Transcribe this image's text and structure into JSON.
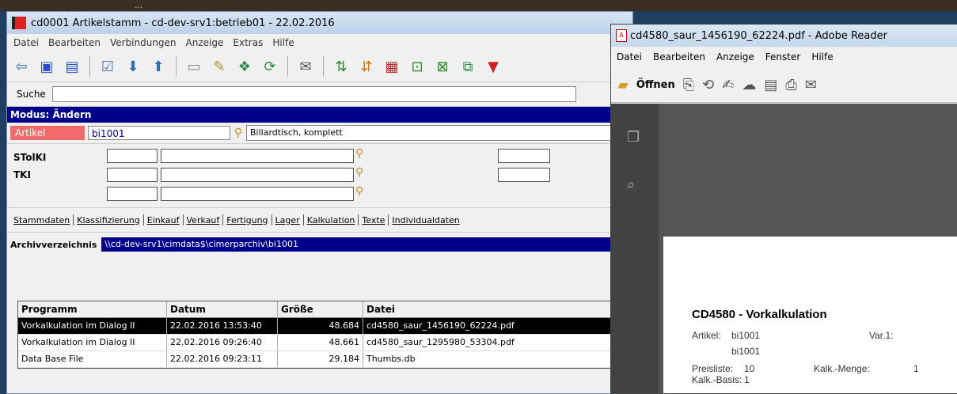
{
  "background": {
    "text": "..."
  },
  "main_window": {
    "title": "cd0001 Artikelstamm - cd-dev-srv1:betrieb01 - 22.02.2016",
    "menu": [
      "Datei",
      "Bearbeiten",
      "Verbindungen",
      "Anzeige",
      "Extras",
      "Hilfe"
    ],
    "search_label": "Suche",
    "mode": "Modus: Ändern",
    "artikel_label": "Artikel",
    "artikel_value": "bi1001",
    "artikel_desc": "Billardtisch, komplett",
    "stk_label": "STolKI",
    "tki_label": "TKI",
    "tabs": [
      "Stammdaten",
      "Klassifizierung",
      "Einkauf",
      "Verkauf",
      "Fertigung",
      "Lager",
      "Kalkulation",
      "Texte",
      "Individualdaten"
    ],
    "archive_label": "Archivverzeichnis",
    "archive_path": "\\\\cd-dev-srv1\\cimdata$\\cimerparchiv\\bi1001",
    "table": {
      "headers": [
        "Programm",
        "Datum",
        "Größe",
        "Datei"
      ],
      "rows": [
        {
          "programm": "Vorkalkulation im Dialog II",
          "datum": "22.02.2016 13:53:40",
          "groesse": "48.684",
          "datei": "cd4580_saur_1456190_62224.pdf"
        },
        {
          "programm": "Vorkalkulation im Dialog II",
          "datum": "22.02.2016 09:26:40",
          "groesse": "48.661",
          "datei": "cd4580_saur_1295980_53304.pdf"
        },
        {
          "programm": "Data Base File",
          "datum": "22.02.2016 09:23:11",
          "groesse": "29.184",
          "datei": "Thumbs.db"
        }
      ]
    }
  },
  "reader_window": {
    "title": "cd4580_saur_1456190_62224.pdf - Adobe Reader",
    "menu": [
      "Datei",
      "Bearbeiten",
      "Anzeige",
      "Fenster",
      "Hilfe"
    ],
    "open_label": "Öffnen",
    "page": {
      "title": "CD4580 - Vorkalkulation",
      "artikel_label": "Artikel:",
      "artikel_value": "bi1001",
      "var_label": "Var.1:",
      "artikel_value2": "bi1001",
      "preisliste_label": "Preisliste:",
      "preisliste_value": "10",
      "kalk_menge_label": "Kalk.-Menge:",
      "kalk_menge_value": "1",
      "kalk_basis_label": "Kalk.-Basis:",
      "kalk_basis_value": "1"
    }
  }
}
